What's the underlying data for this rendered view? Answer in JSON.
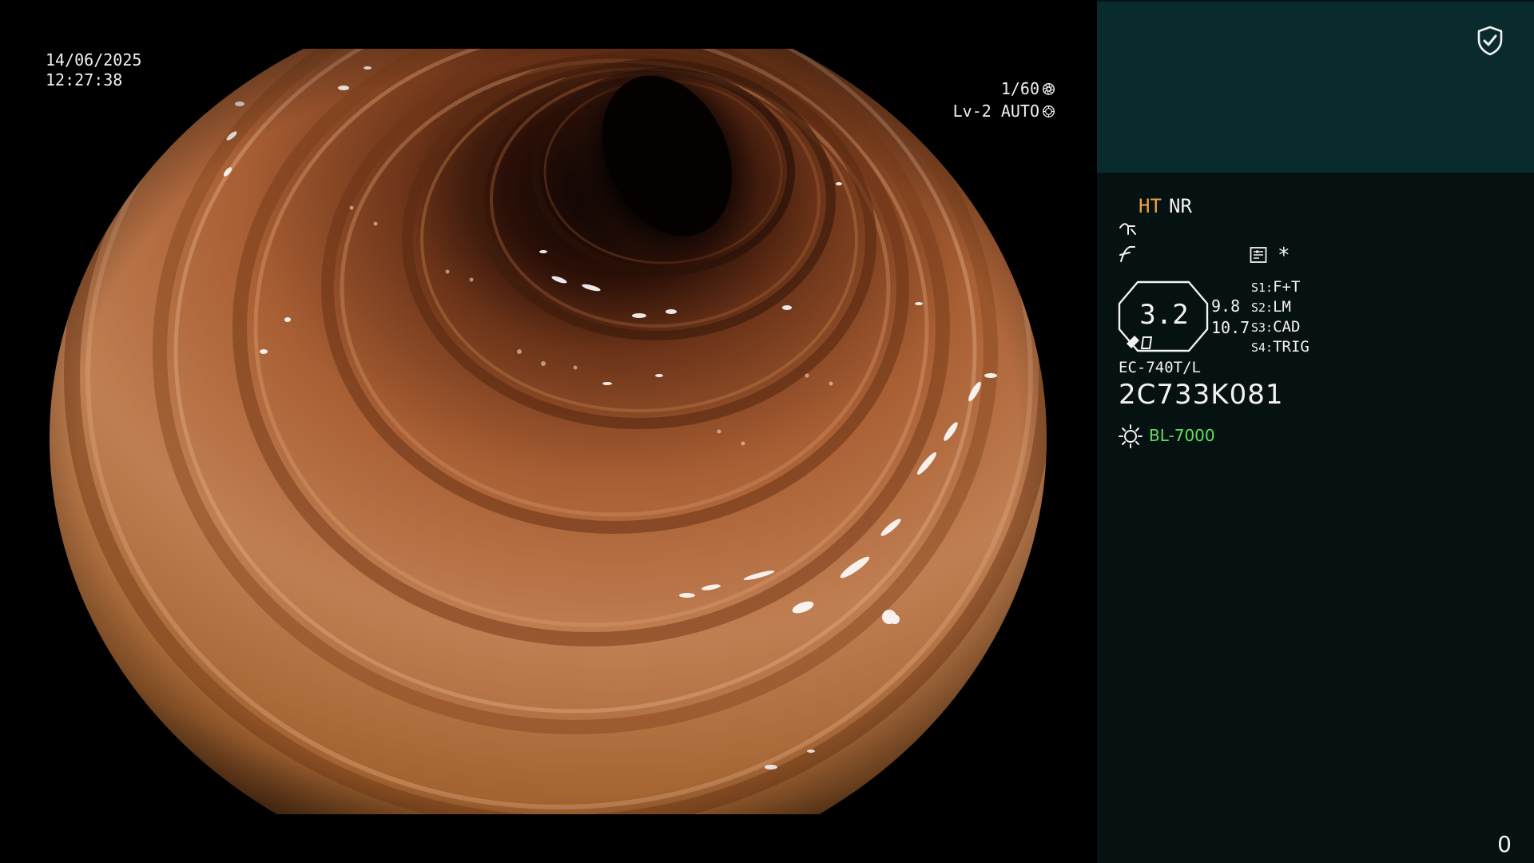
{
  "osd": {
    "date": "14/06/2025",
    "time": "12:27:38",
    "shutter": "1/60",
    "iris": "Lv-2 AUTO",
    "shutter_icon": "aperture-icon",
    "iris_icon": "iris-icon"
  },
  "panel": {
    "shield_icon": "shield-check-icon",
    "ht_label": "HT",
    "nr_label": "NR",
    "star_label": "*",
    "zoom_value": "3.2",
    "value_top": "9.8",
    "value_bottom": "10.7",
    "switches": [
      {
        "key": "S1:",
        "value": "F+T"
      },
      {
        "key": "S2:",
        "value": "LM"
      },
      {
        "key": "S3:",
        "value": "CAD"
      },
      {
        "key": "S4:",
        "value": "TRIG"
      }
    ],
    "scope_model": "EC-740T/L",
    "scope_serial": "2C733K081",
    "light_source": "BL-7000",
    "counter": "0"
  },
  "colors": {
    "background": "#000000",
    "panel_bg": "#061112",
    "panel_top_bg": "#0a2b2d",
    "ht_color": "#f0a040",
    "light_source_color": "#5fe05f",
    "tissue_base": "#b8703a"
  }
}
